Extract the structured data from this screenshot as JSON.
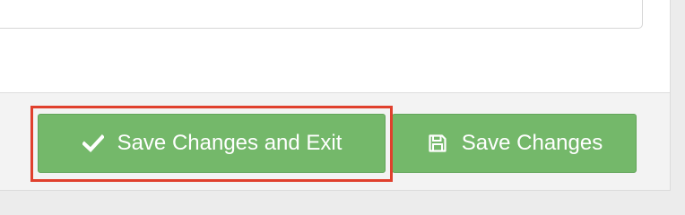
{
  "footer": {
    "save_exit_label": "Save Changes and Exit",
    "save_label": "Save Changes"
  },
  "icons": {
    "save_exit": "check-icon",
    "save": "floppy-disk-icon"
  },
  "colors": {
    "button_green": "#74b86a",
    "highlight_red": "#e0402d"
  }
}
